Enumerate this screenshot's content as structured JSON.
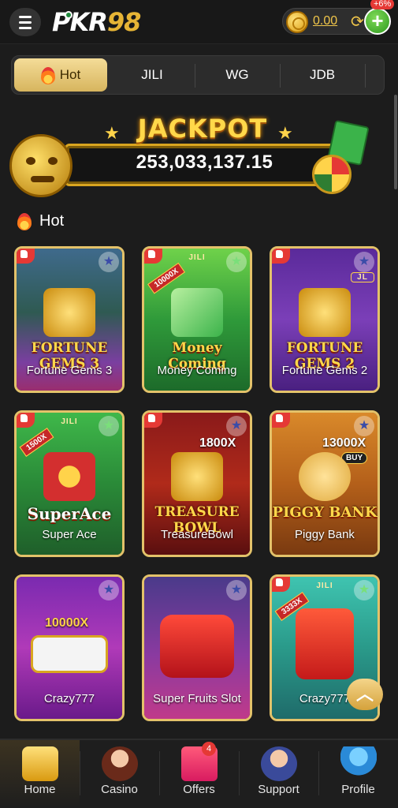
{
  "header": {
    "logo_main": "PKR",
    "logo_num": "98",
    "balance": "0.00",
    "bonus_badge": "+6%",
    "plus_symbol": "+",
    "refresh_symbol": "⟳"
  },
  "tabs": [
    {
      "label": "Hot",
      "active": true
    },
    {
      "label": "JILI"
    },
    {
      "label": "WG"
    },
    {
      "label": "JDB"
    }
  ],
  "jackpot": {
    "title": "JACKPOT",
    "value": "253,033,137.15"
  },
  "section": {
    "title": "Hot"
  },
  "games": [
    {
      "name": "Fortune Gems 3",
      "logo": "FORTUNE GEMS 3"
    },
    {
      "name": "Money Coming",
      "logo": "Money Coming",
      "tag": "JILI",
      "ribbon": "10000X"
    },
    {
      "name": "Fortune Gems 2",
      "logo": "FORTUNE GEMS 2",
      "tag": "JL"
    },
    {
      "name": "Super Ace",
      "logo": "SuperAce",
      "tag": "JILI",
      "ribbon": "1500X"
    },
    {
      "name": "TreasureBowl",
      "logo": "TREASURE BOWL",
      "multiplier": "1800X"
    },
    {
      "name": "Piggy Bank",
      "logo": "PIGGY BANK",
      "multiplier": "13000X",
      "buy": "BUY"
    },
    {
      "name": "Crazy777",
      "multiplier": "10000X"
    },
    {
      "name": "Super Fruits Slot"
    },
    {
      "name": "Crazy777",
      "tag": "JILI",
      "ribbon": "3333X"
    }
  ],
  "bottom_nav": [
    {
      "label": "Home",
      "icon": "home-777-icon",
      "active": true
    },
    {
      "label": "Casino",
      "icon": "casino-dealer-icon"
    },
    {
      "label": "Offers",
      "icon": "gift-icon",
      "badge": "4"
    },
    {
      "label": "Support",
      "icon": "support-agent-icon"
    },
    {
      "label": "Profile",
      "icon": "profile-icon"
    }
  ],
  "back_to_top_symbol": "︿",
  "colors": {
    "accent_gold": "#e3c26a",
    "background": "#1c1c1c",
    "favorite_star": "#3b4ca8"
  }
}
